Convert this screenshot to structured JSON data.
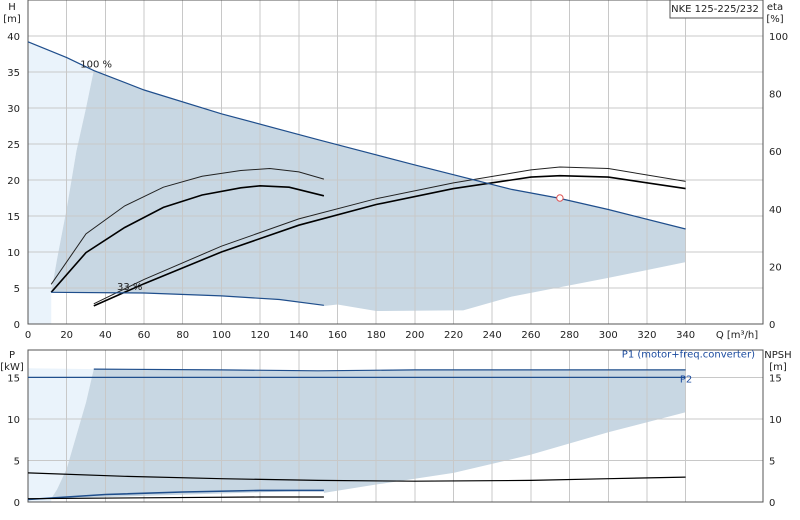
{
  "title_box": "NKE 125-225/232",
  "chart_data": [
    {
      "type": "line",
      "name": "QH",
      "xlabel": "Q [m³/h]",
      "ylabel": "H\n[m]",
      "y2label": "eta\n[%]",
      "xlim": [
        0,
        380
      ],
      "ylim": [
        0,
        45
      ],
      "y2lim": [
        0,
        112.5
      ],
      "xticks": [
        0,
        20,
        40,
        60,
        80,
        100,
        120,
        140,
        160,
        180,
        200,
        220,
        240,
        260,
        280,
        300,
        320,
        340
      ],
      "yticks": [
        0,
        5,
        10,
        15,
        20,
        25,
        30,
        35,
        40
      ],
      "y2ticks": [
        0,
        20,
        40,
        60,
        80,
        100
      ],
      "grid": true,
      "annotations": [
        {
          "text": "100 %",
          "x": 27,
          "y": 35.6
        },
        {
          "text": "33 %",
          "x": 46,
          "y": 4.7
        }
      ],
      "envelope_area": {
        "top": [
          [
            0,
            39.2
          ],
          [
            20,
            37
          ],
          [
            34,
            35.2
          ],
          [
            60,
            32.5
          ],
          [
            100,
            29.2
          ],
          [
            150,
            25.6
          ],
          [
            200,
            22.1
          ],
          [
            250,
            18.7
          ],
          [
            274,
            17.5
          ],
          [
            300,
            15.9
          ],
          [
            340,
            13.2
          ]
        ],
        "bottom": [
          [
            153,
            2.5
          ],
          [
            160,
            2.7
          ],
          [
            180,
            1.8
          ],
          [
            220,
            1.9
          ],
          [
            225,
            1.9
          ],
          [
            250,
            3.8
          ],
          [
            300,
            6.4
          ],
          [
            340,
            8.6
          ]
        ],
        "low_curve": [
          [
            12,
            4.4
          ],
          [
            60,
            4.3
          ],
          [
            100,
            3.9
          ],
          [
            130,
            3.4
          ],
          [
            153,
            2.6
          ]
        ],
        "left_edge": [
          [
            34,
            35.2
          ],
          [
            30,
            30
          ],
          [
            25,
            24
          ],
          [
            20,
            16
          ],
          [
            15,
            9
          ],
          [
            12,
            4.4
          ]
        ]
      },
      "series": [
        {
          "name": "100 %",
          "values_xy": [
            [
              0,
              39.2
            ],
            [
              20,
              37
            ],
            [
              34,
              35.2
            ],
            [
              60,
              32.5
            ],
            [
              100,
              29.2
            ],
            [
              150,
              25.6
            ],
            [
              200,
              22.1
            ],
            [
              250,
              18.7
            ],
            [
              274,
              17.5
            ],
            [
              300,
              15.9
            ],
            [
              340,
              13.2
            ]
          ],
          "color": "#1f4e8c"
        },
        {
          "name": "33 %",
          "values_xy": [
            [
              12,
              4.4
            ],
            [
              60,
              4.3
            ],
            [
              100,
              3.9
            ],
            [
              130,
              3.4
            ],
            [
              153,
              2.6
            ]
          ],
          "color": "#1f4e8c"
        }
      ],
      "eta_curves": [
        {
          "values_xy": [
            [
              12,
              13.8
            ],
            [
              30,
              31.3
            ],
            [
              50,
              41
            ],
            [
              70,
              47.5
            ],
            [
              90,
              51.3
            ],
            [
              110,
              53.3
            ],
            [
              125,
              54
            ],
            [
              140,
              52.8
            ],
            [
              153,
              50.3
            ]
          ],
          "color": "#222"
        },
        {
          "values_xy": [
            [
              12,
              11
            ],
            [
              30,
              24.8
            ],
            [
              50,
              33.5
            ],
            [
              70,
              40.5
            ],
            [
              90,
              44.8
            ],
            [
              110,
              47.3
            ],
            [
              120,
              48
            ],
            [
              135,
              47.5
            ],
            [
              153,
              44.5
            ]
          ],
          "color": "#000"
        },
        {
          "values_xy": [
            [
              34,
              7
            ],
            [
              60,
              15.5
            ],
            [
              100,
              27
            ],
            [
              140,
              36.5
            ],
            [
              180,
              43.5
            ],
            [
              220,
              49
            ],
            [
              260,
              53.5
            ],
            [
              275,
              54.5
            ],
            [
              300,
              54
            ],
            [
              340,
              49.5
            ]
          ],
          "color": "#222"
        },
        {
          "values_xy": [
            [
              34,
              6.3
            ],
            [
              60,
              14
            ],
            [
              100,
              25
            ],
            [
              140,
              34.3
            ],
            [
              180,
              41.5
            ],
            [
              220,
              47
            ],
            [
              260,
              51
            ],
            [
              275,
              51.5
            ],
            [
              300,
              51
            ],
            [
              340,
              47
            ]
          ],
          "color": "#000"
        }
      ],
      "operating_point": {
        "x": 275,
        "y": 17.5
      }
    },
    {
      "type": "line",
      "name": "Power_NPSH",
      "ylabel": "P\n[kW]",
      "y2label": "NPSH\n[m]",
      "ylim": [
        0,
        18.3
      ],
      "yticks": [
        0,
        5,
        10,
        15
      ],
      "y2ticks": [
        0,
        5,
        10,
        15
      ],
      "legend": [
        {
          "text": "P1 (motor+freq.converter)",
          "x": 307,
          "y": 17.4
        },
        {
          "text": "P2",
          "x": 337,
          "y": 14.4
        }
      ],
      "envelope_area": {
        "top": [
          [
            34,
            16
          ],
          [
            100,
            15.9
          ],
          [
            150,
            15.8
          ],
          [
            200,
            15.9
          ],
          [
            250,
            15.9
          ],
          [
            300,
            15.9
          ],
          [
            340,
            15.9
          ]
        ],
        "bottom": [
          [
            153,
            1.1
          ],
          [
            180,
            2.1
          ],
          [
            220,
            3.5
          ],
          [
            260,
            5.7
          ],
          [
            300,
            8.4
          ],
          [
            340,
            10.8
          ]
        ],
        "left_edge": [
          [
            34,
            16
          ],
          [
            30,
            12
          ],
          [
            25,
            8
          ],
          [
            20,
            4
          ],
          [
            15,
            1.5
          ],
          [
            12,
            0.4
          ]
        ],
        "low_curve": [
          [
            0,
            0.3
          ],
          [
            40,
            0.9
          ],
          [
            80,
            1.2
          ],
          [
            120,
            1.4
          ],
          [
            153,
            1.4
          ]
        ]
      },
      "series": [
        {
          "name": "P1 (motor+freq.converter)",
          "values_xy": [
            [
              34,
              16
            ],
            [
              100,
              15.9
            ],
            [
              150,
              15.8
            ],
            [
              200,
              15.9
            ],
            [
              250,
              15.9
            ],
            [
              300,
              15.9
            ],
            [
              340,
              15.9
            ]
          ],
          "color": "#1f4e8c"
        },
        {
          "name": "P2",
          "values_xy": [
            [
              0,
              15
            ],
            [
              100,
              15
            ],
            [
              200,
              15
            ],
            [
              300,
              15
            ],
            [
              340,
              15
            ]
          ],
          "color": "#1f4e8c"
        }
      ],
      "npsh_curves": [
        {
          "values_xy": [
            [
              0,
              3.5
            ],
            [
              50,
              3.1
            ],
            [
              100,
              2.8
            ],
            [
              150,
              2.6
            ],
            [
              200,
              2.5
            ],
            [
              260,
              2.6
            ],
            [
              300,
              2.8
            ],
            [
              340,
              3
            ]
          ],
          "color": "#000"
        },
        {
          "values_xy": [
            [
              0,
              0.4
            ],
            [
              60,
              0.5
            ],
            [
              120,
              0.6
            ],
            [
              153,
              0.6
            ]
          ],
          "color": "#000"
        }
      ]
    }
  ]
}
